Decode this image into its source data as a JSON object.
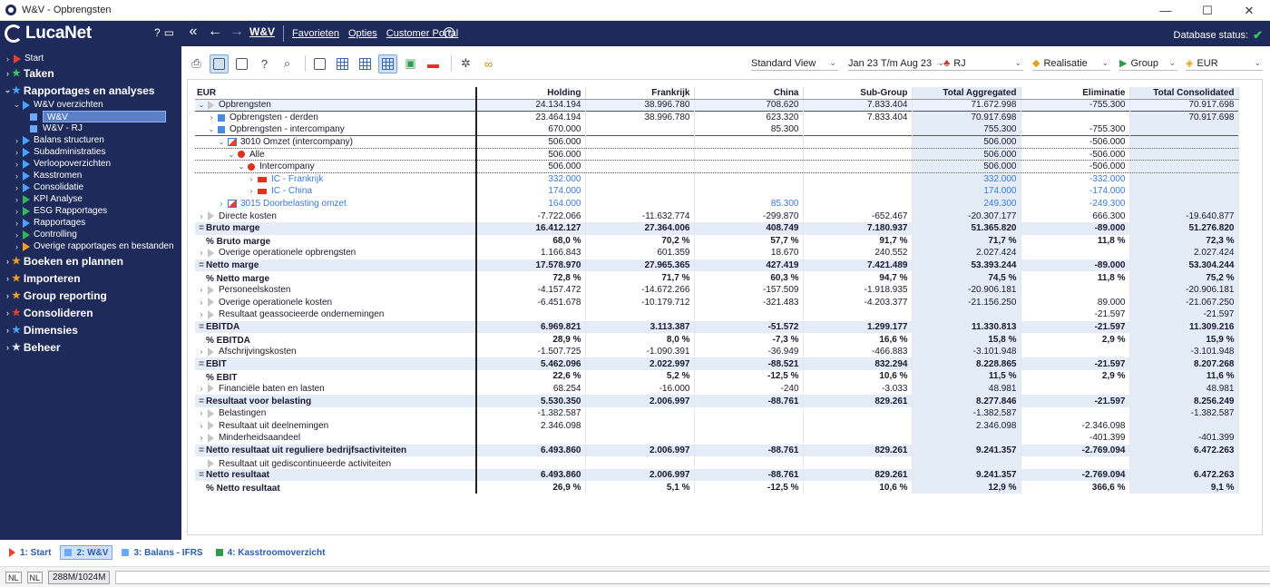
{
  "window": {
    "title": "W&V - Opbrengsten",
    "min": "—",
    "max": "☐",
    "close": "✕"
  },
  "header": {
    "logo": "LucaNet",
    "breadcrumb": "W&V",
    "menu": [
      "Favorieten",
      "Opties",
      "Customer Portal"
    ],
    "db_status": "Database status:"
  },
  "sidebar": {
    "items": [
      {
        "label": "Start",
        "level": 0,
        "kind": "tri-red",
        "big": false
      },
      {
        "label": "Taken",
        "level": 0,
        "kind": "star-green",
        "big": true
      },
      {
        "label": "Rapportages en analyses",
        "level": 0,
        "kind": "star-blue",
        "big": true,
        "open": true
      },
      {
        "label": "W&V overzichten",
        "level": 1,
        "kind": "tri-blue",
        "open": true
      },
      {
        "label": "W&V",
        "level": 2,
        "kind": "sq",
        "selected": true
      },
      {
        "label": "W&V - RJ",
        "level": 2,
        "kind": "sq"
      },
      {
        "label": "Balans structuren",
        "level": 1,
        "kind": "tri-blue"
      },
      {
        "label": "Subadministraties",
        "level": 1,
        "kind": "tri-blue"
      },
      {
        "label": "Verloopoverzichten",
        "level": 1,
        "kind": "tri-blue"
      },
      {
        "label": "Kasstromen",
        "level": 1,
        "kind": "tri-blue"
      },
      {
        "label": "Consolidatie",
        "level": 1,
        "kind": "tri-blue"
      },
      {
        "label": "KPI Analyse",
        "level": 1,
        "kind": "tri-green"
      },
      {
        "label": "ESG Rapportages",
        "level": 1,
        "kind": "tri-green"
      },
      {
        "label": "Rapportages",
        "level": 1,
        "kind": "tri-blue"
      },
      {
        "label": "Controlling",
        "level": 1,
        "kind": "tri-green"
      },
      {
        "label": "Overige rapportages en bestanden",
        "level": 1,
        "kind": "tri-orange"
      },
      {
        "label": "Boeken en plannen",
        "level": 0,
        "kind": "star-orange",
        "big": true
      },
      {
        "label": "Importeren",
        "level": 0,
        "kind": "star-orange",
        "big": true
      },
      {
        "label": "Group reporting",
        "level": 0,
        "kind": "star-orange",
        "big": true
      },
      {
        "label": "Consolideren",
        "level": 0,
        "kind": "star-red",
        "big": true
      },
      {
        "label": "Dimensies",
        "level": 0,
        "kind": "star-blue",
        "big": true
      },
      {
        "label": "Beheer",
        "level": 0,
        "kind": "star-white",
        "big": true
      }
    ]
  },
  "toolbar": {
    "view": "Standard View",
    "period": "Jan 23 T/m Aug 23",
    "gaap": "RJ",
    "data_level": "Realisatie",
    "company": "Group",
    "currency": "EUR"
  },
  "colors": {
    "navy": "#1e2a5a",
    "accent_blue": "#3a7bd5",
    "highlight": "#e4ecf8",
    "ok_green": "#3fc35f"
  },
  "grid": {
    "columns": [
      "EUR",
      "Holding",
      "Frankrijk",
      "China",
      "Sub-Group",
      "Total Aggregated",
      "Eliminatie",
      "Total Consolidated"
    ],
    "rows": [
      {
        "label": "Opbrengsten",
        "indent": 0,
        "ctl": "chev-down",
        "icon": "ptri",
        "style": "sel-first",
        "values": [
          "24.134.194",
          "38.996.780",
          "708.620",
          "7.833.404",
          "71.672.998",
          "-755.300",
          "70.917.698"
        ]
      },
      {
        "label": "Opbrengsten - derden",
        "indent": 1,
        "ctl": "chev-right",
        "icon": "bsq",
        "style": "solidtop",
        "values": [
          "23.464.194",
          "38.996.780",
          "623.320",
          "7.833.404",
          "70.917.698",
          "",
          "70.917.698"
        ]
      },
      {
        "label": "Opbrengsten - intercompany",
        "indent": 1,
        "ctl": "chev-down",
        "icon": "bsq",
        "style": "",
        "values": [
          "670.000",
          "",
          "85.300",
          "",
          "755.300",
          "-755.300",
          ""
        ]
      },
      {
        "label": "3010 Omzet (intercompany)",
        "indent": 2,
        "ctl": "chev-down",
        "icon": "flagic",
        "style": "solidtop dotted",
        "values": [
          "506.000",
          "",
          "",
          "",
          "506.000",
          "-506.000",
          ""
        ]
      },
      {
        "label": "Alle",
        "indent": 3,
        "ctl": "chev-down",
        "icon": "rdot",
        "style": "dotted",
        "values": [
          "506.000",
          "",
          "",
          "",
          "506.000",
          "-506.000",
          ""
        ]
      },
      {
        "label": "Intercompany",
        "indent": 4,
        "ctl": "chev-down",
        "icon": "rdot",
        "style": "dotted",
        "values": [
          "506.000",
          "",
          "",
          "",
          "506.000",
          "-506.000",
          ""
        ]
      },
      {
        "label": "IC - Frankrijk",
        "indent": 5,
        "ctl": "chev-right",
        "icon": "rflag",
        "style": "blue",
        "values": [
          "332.000",
          "",
          "",
          "",
          "332.000",
          "-332.000",
          ""
        ]
      },
      {
        "label": "IC - China",
        "indent": 5,
        "ctl": "chev-right",
        "icon": "rflag",
        "style": "blue",
        "values": [
          "174.000",
          "",
          "",
          "",
          "174.000",
          "-174.000",
          ""
        ]
      },
      {
        "label": "3015 Doorbelasting omzet",
        "indent": 2,
        "ctl": "chev-right",
        "icon": "flagic",
        "style": "blue",
        "values": [
          "164.000",
          "",
          "85.300",
          "",
          "249.300",
          "-249.300",
          ""
        ]
      },
      {
        "label": "Directe kosten",
        "indent": 0,
        "ctl": "chev-right",
        "icon": "ptri",
        "style": "",
        "values": [
          "-7.722.066",
          "-11.632.774",
          "-299.870",
          "-652.467",
          "-20.307.177",
          "666.300",
          "-19.640.877"
        ]
      },
      {
        "label": "Bruto marge",
        "indent": 0,
        "ctl": "eq",
        "icon": "",
        "style": "subtotal",
        "values": [
          "16.412.127",
          "27.364.006",
          "408.749",
          "7.180.937",
          "51.365.820",
          "-89.000",
          "51.276.820"
        ]
      },
      {
        "label": "% Bruto marge",
        "indent": 0,
        "ctl": "",
        "icon": "",
        "style": "pct",
        "values": [
          "68,0 %",
          "70,2 %",
          "57,7 %",
          "91,7 %",
          "71,7 %",
          "11,8 %",
          "72,3 %"
        ]
      },
      {
        "label": "Overige operationele opbrengsten",
        "indent": 0,
        "ctl": "chev-right",
        "icon": "ptri",
        "style": "",
        "values": [
          "1.166.843",
          "601.359",
          "18.670",
          "240.552",
          "2.027.424",
          "",
          "2.027.424"
        ]
      },
      {
        "label": "Netto marge",
        "indent": 0,
        "ctl": "eq",
        "icon": "",
        "style": "subtotal",
        "values": [
          "17.578.970",
          "27.965.365",
          "427.419",
          "7.421.489",
          "53.393.244",
          "-89.000",
          "53.304.244"
        ]
      },
      {
        "label": "% Netto marge",
        "indent": 0,
        "ctl": "",
        "icon": "",
        "style": "pct",
        "values": [
          "72,8 %",
          "71,7 %",
          "60,3 %",
          "94,7 %",
          "74,5 %",
          "11,8 %",
          "75,2 %"
        ]
      },
      {
        "label": "Personeelskosten",
        "indent": 0,
        "ctl": "chev-right",
        "icon": "ptri",
        "style": "",
        "values": [
          "-4.157.472",
          "-14.672.266",
          "-157.509",
          "-1.918.935",
          "-20.906.181",
          "",
          "-20.906.181"
        ]
      },
      {
        "label": "Overige operationele kosten",
        "indent": 0,
        "ctl": "chev-right",
        "icon": "ptri",
        "style": "",
        "values": [
          "-6.451.678",
          "-10.179.712",
          "-321.483",
          "-4.203.377",
          "-21.156.250",
          "89.000",
          "-21.067.250"
        ]
      },
      {
        "label": "Resultaat geassocieerde ondernemingen",
        "indent": 0,
        "ctl": "chev-right",
        "icon": "ptri",
        "style": "",
        "values": [
          "",
          "",
          "",
          "",
          "",
          "-21.597",
          "-21.597"
        ]
      },
      {
        "label": "EBITDA",
        "indent": 0,
        "ctl": "eq",
        "icon": "",
        "style": "subtotal",
        "values": [
          "6.969.821",
          "3.113.387",
          "-51.572",
          "1.299.177",
          "11.330.813",
          "-21.597",
          "11.309.216"
        ]
      },
      {
        "label": "% EBITDA",
        "indent": 0,
        "ctl": "",
        "icon": "",
        "style": "pct",
        "values": [
          "28,9 %",
          "8,0 %",
          "-7,3 %",
          "16,6 %",
          "15,8 %",
          "2,9 %",
          "15,9 %"
        ]
      },
      {
        "label": "Afschrijvingskosten",
        "indent": 0,
        "ctl": "chev-right",
        "icon": "ptri",
        "style": "",
        "values": [
          "-1.507.725",
          "-1.090.391",
          "-36.949",
          "-466.883",
          "-3.101.948",
          "",
          "-3.101.948"
        ]
      },
      {
        "label": "EBIT",
        "indent": 0,
        "ctl": "eq",
        "icon": "",
        "style": "subtotal",
        "values": [
          "5.462.096",
          "2.022.997",
          "-88.521",
          "832.294",
          "8.228.865",
          "-21.597",
          "8.207.268"
        ]
      },
      {
        "label": "% EBIT",
        "indent": 0,
        "ctl": "",
        "icon": "",
        "style": "pct",
        "values": [
          "22,6 %",
          "5,2 %",
          "-12,5 %",
          "10,6 %",
          "11,5 %",
          "2,9 %",
          "11,6 %"
        ]
      },
      {
        "label": "Financiële baten en lasten",
        "indent": 0,
        "ctl": "chev-right",
        "icon": "ptri",
        "style": "",
        "values": [
          "68.254",
          "-16.000",
          "-240",
          "-3.033",
          "48.981",
          "",
          "48.981"
        ]
      },
      {
        "label": "Resultaat voor belasting",
        "indent": 0,
        "ctl": "eq",
        "icon": "",
        "style": "subtotal",
        "values": [
          "5.530.350",
          "2.006.997",
          "-88.761",
          "829.261",
          "8.277.846",
          "-21.597",
          "8.256.249"
        ]
      },
      {
        "label": "Belastingen",
        "indent": 0,
        "ctl": "chev-right",
        "icon": "ptri",
        "style": "",
        "values": [
          "-1.382.587",
          "",
          "",
          "",
          "-1.382.587",
          "",
          "-1.382.587"
        ]
      },
      {
        "label": "Resultaat uit deelnemingen",
        "indent": 0,
        "ctl": "chev-right",
        "icon": "ptri",
        "style": "",
        "values": [
          "2.346.098",
          "",
          "",
          "",
          "2.346.098",
          "-2.346.098",
          ""
        ]
      },
      {
        "label": "Minderheidsaandeel",
        "indent": 0,
        "ctl": "chev-right",
        "icon": "ptri",
        "style": "",
        "values": [
          "",
          "",
          "",
          "",
          "",
          "-401.399",
          "-401.399"
        ]
      },
      {
        "label": "Netto resultaat uit reguliere bedrijfsactiviteiten",
        "indent": 0,
        "ctl": "eq",
        "icon": "",
        "style": "subtotal",
        "values": [
          "6.493.860",
          "2.006.997",
          "-88.761",
          "829.261",
          "9.241.357",
          "-2.769.094",
          "6.472.263"
        ]
      },
      {
        "label": "Resultaat uit gediscontinueerde activiteiten",
        "indent": 0,
        "ctl": "",
        "icon": "ptri",
        "style": "",
        "values": [
          "",
          "",
          "",
          "",
          "",
          "",
          ""
        ]
      },
      {
        "label": "Netto resultaat",
        "indent": 0,
        "ctl": "eq",
        "icon": "",
        "style": "subtotal",
        "values": [
          "6.493.860",
          "2.006.997",
          "-88.761",
          "829.261",
          "9.241.357",
          "-2.769.094",
          "6.472.263"
        ]
      },
      {
        "label": "% Netto resultaat",
        "indent": 0,
        "ctl": "",
        "icon": "",
        "style": "pct",
        "values": [
          "26,9 %",
          "5,1 %",
          "-12,5 %",
          "10,6 %",
          "12,9 %",
          "366,6 %",
          "9,1 %"
        ]
      }
    ]
  },
  "tabs": [
    {
      "label": "1: Start",
      "kind": "tri",
      "active": false
    },
    {
      "label": "2: W&V",
      "kind": "sq",
      "active": true
    },
    {
      "label": "3: Balans - IFRS",
      "kind": "sq",
      "active": false
    },
    {
      "label": "4: Kasstroomoverzicht",
      "kind": "sq-green",
      "active": false
    }
  ],
  "status": {
    "lang1": "NL",
    "lang2": "NL",
    "memory": "288M/1024M"
  }
}
